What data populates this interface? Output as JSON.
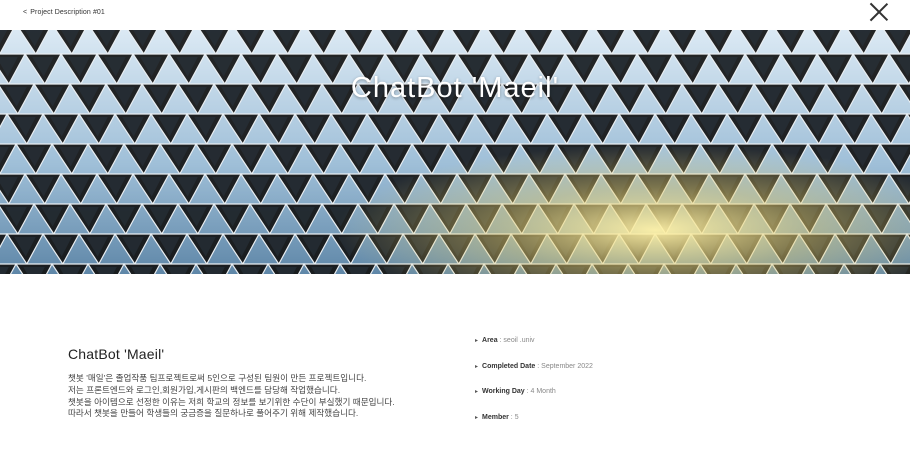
{
  "header": {
    "breadcrumb": "Project Description #01",
    "breadcrumb_mark": "<",
    "close_icon": "close-icon"
  },
  "hero": {
    "title": "ChatBot 'Maeil'",
    "colors": {
      "sky_top": "#cfe2f0",
      "sky_low": "#7ea7c6",
      "frame": "#141414",
      "glow": "#ffe58a"
    }
  },
  "project": {
    "title": "ChatBot 'Maeil'",
    "description": [
      "챗봇 '매일'은 졸업작품 팀프로젝트로써 5인으로 구성된 팀원이 만든 프로젝트입니다.",
      "저는 프론트엔드와 로그인,회원가입,게시판의 백엔드를 담당해 작업했습니다.",
      "챗봇을 아이템으로 선정한 이유는 저희 학교의 정보를 보기위한 수단이 부실했기 때문입니다.",
      "따라서 챗봇을 만들어 학생들의 궁금증을 질문하나로 풀어주기 위해 제작했습니다."
    ]
  },
  "meta": [
    {
      "key": "Area",
      "value": " : seoil .univ"
    },
    {
      "key": "Completed Date",
      "value": " : September 2022"
    },
    {
      "key": "Working Day",
      "value": " : 4 Month"
    },
    {
      "key": "Member",
      "value": " : 5"
    }
  ]
}
